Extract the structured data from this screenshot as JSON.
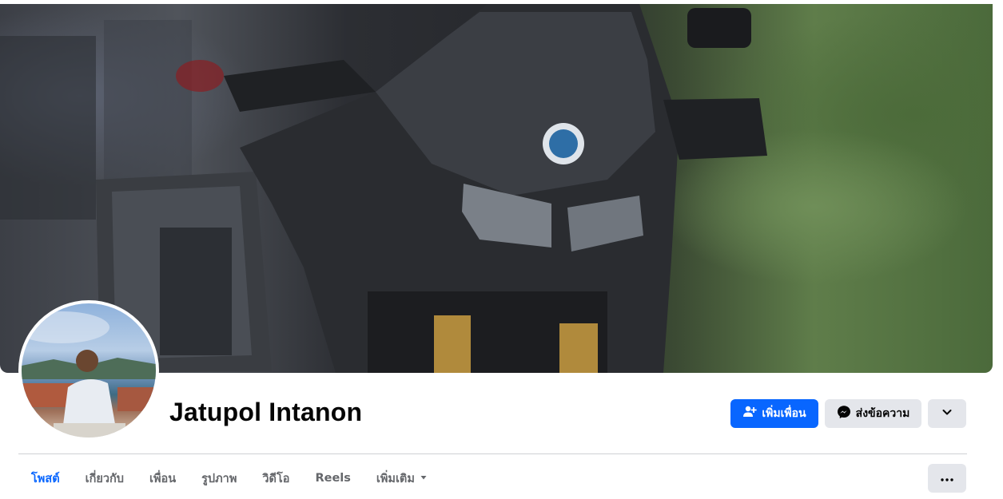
{
  "profile": {
    "name": "Jatupol Intanon"
  },
  "actions": {
    "add_friend_label": "เพิ่มเพื่อน",
    "message_label": "ส่งข้อความ"
  },
  "tabs": [
    {
      "label": "โพสต์",
      "active": true
    },
    {
      "label": "เกี่ยวกับ",
      "active": false
    },
    {
      "label": "เพื่อน",
      "active": false
    },
    {
      "label": "รูปภาพ",
      "active": false
    },
    {
      "label": "วิดีโอ",
      "active": false
    },
    {
      "label": "Reels",
      "active": false
    },
    {
      "label": "เพิ่มเติม",
      "active": false
    }
  ],
  "icons": {
    "add_friend": "person-plus-icon",
    "message": "messenger-icon",
    "more_actions": "chevron-down-icon",
    "tab_more_caret": "caret-down-icon",
    "tabs_overflow": "ellipsis-icon"
  },
  "colors": {
    "accent": "#0866ff",
    "secondary_button": "#e4e6eb",
    "tab_text": "#65676b",
    "divider": "#ced0d4"
  }
}
